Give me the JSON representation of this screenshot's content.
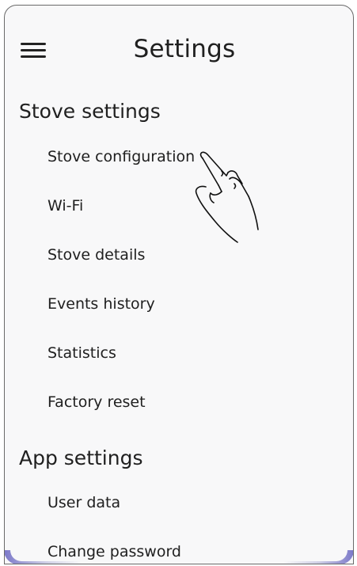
{
  "header": {
    "title": "Settings",
    "menu_icon": "hamburger-menu-icon"
  },
  "sections": [
    {
      "title": "Stove settings",
      "items": [
        {
          "label": "Stove configuration"
        },
        {
          "label": "Wi-Fi"
        },
        {
          "label": "Stove details"
        },
        {
          "label": "Events history"
        },
        {
          "label": "Statistics"
        },
        {
          "label": "Factory reset"
        }
      ]
    },
    {
      "title": "App settings",
      "items": [
        {
          "label": "User data"
        },
        {
          "label": "Change password"
        }
      ]
    }
  ],
  "overlay": {
    "pointer_icon": "tap-hand-icon"
  },
  "colors": {
    "background": "#f8f8f9",
    "text": "#202020",
    "accent": "#7b78c9"
  }
}
